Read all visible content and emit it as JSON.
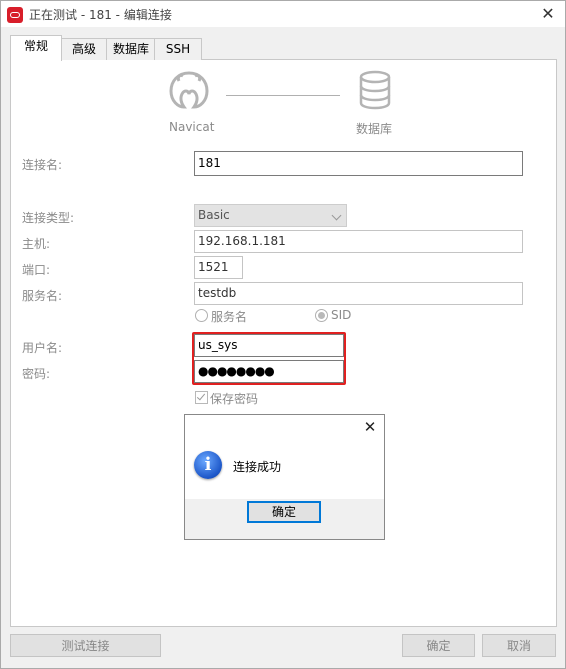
{
  "window": {
    "title": "正在测试 - 181 - 编辑连接",
    "close_glyph": "✕"
  },
  "tabs": [
    {
      "label": "常规",
      "active": true
    },
    {
      "label": "高级",
      "active": false
    },
    {
      "label": "数据库",
      "active": false
    },
    {
      "label": "SSH",
      "active": false
    }
  ],
  "header": {
    "left_logo_label": "Navicat",
    "right_logo_label": "数据库",
    "left_icon": "navicat-logo-icon",
    "right_icon": "database-icon"
  },
  "form": {
    "connection_name": {
      "label": "连接名:",
      "value": "181"
    },
    "connection_type": {
      "label": "连接类型:",
      "value": "Basic"
    },
    "host": {
      "label": "主机:",
      "value": "192.168.1.181"
    },
    "port": {
      "label": "端口:",
      "value": "1521"
    },
    "service_name": {
      "label": "服务名:",
      "value": "testdb"
    },
    "service_type_options": [
      {
        "label": "服务名",
        "selected": false
      },
      {
        "label": "SID",
        "selected": true
      }
    ],
    "username": {
      "label": "用户名:",
      "value": "us_sys"
    },
    "password": {
      "label": "密码:",
      "value": "●●●●●●●●"
    },
    "save_password": {
      "label": "保存密码",
      "checked": true
    }
  },
  "buttons": {
    "test": "测试连接",
    "ok": "确定",
    "cancel": "取消"
  },
  "dialog": {
    "message": "连接成功",
    "ok": "确定",
    "icon": "info-icon",
    "close_glyph": "✕"
  },
  "colors": {
    "highlight_border": "#e02020",
    "dialog_focus": "#0078d7",
    "brand_red": "#d81e2a"
  }
}
